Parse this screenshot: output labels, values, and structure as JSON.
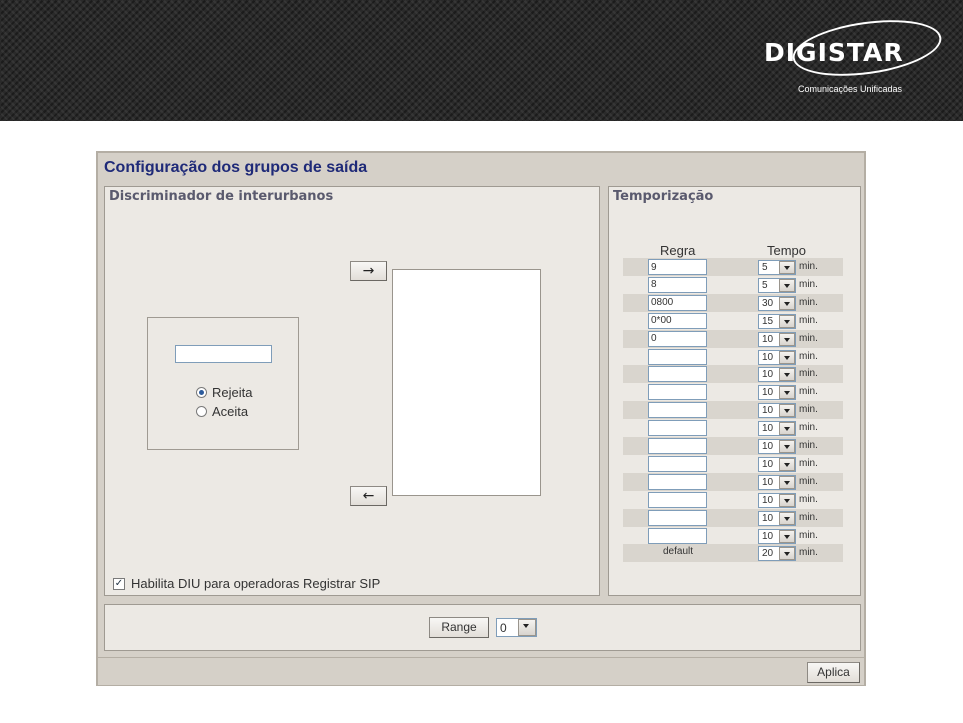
{
  "header": {
    "logo_text": "DIGISTAR",
    "logo_subtitle": "Comunicações Unificadas"
  },
  "panel": {
    "title": "Configuração dos grupos de saída"
  },
  "discriminator": {
    "title": "Discriminador de interurbanos",
    "add_arrow": "→",
    "remove_arrow": "←",
    "number_input_value": "",
    "radio_reject_label": "Rejeita",
    "radio_accept_label": "Aceita",
    "selected_radio": "Rejeita",
    "checkbox_label": "Habilita DIU para operadoras Registrar SIP",
    "checkbox_checked": true
  },
  "timing": {
    "title": "Temporização",
    "col_rule": "Regra",
    "col_time": "Tempo",
    "unit": "min.",
    "rows": [
      {
        "rule": "9",
        "time": "5"
      },
      {
        "rule": "8",
        "time": "5"
      },
      {
        "rule": "0800",
        "time": "30"
      },
      {
        "rule": "0*00",
        "time": "15"
      },
      {
        "rule": "0",
        "time": "10"
      },
      {
        "rule": "",
        "time": "10"
      },
      {
        "rule": "",
        "time": "10"
      },
      {
        "rule": "",
        "time": "10"
      },
      {
        "rule": "",
        "time": "10"
      },
      {
        "rule": "",
        "time": "10"
      },
      {
        "rule": "",
        "time": "10"
      },
      {
        "rule": "",
        "time": "10"
      },
      {
        "rule": "",
        "time": "10"
      },
      {
        "rule": "",
        "time": "10"
      },
      {
        "rule": "",
        "time": "10"
      },
      {
        "rule": "",
        "time": "10"
      }
    ],
    "default_label": "default",
    "default_time": "20"
  },
  "range": {
    "button_label": "Range",
    "selected_value": "0"
  },
  "footer": {
    "apply_label": "Aplica"
  }
}
